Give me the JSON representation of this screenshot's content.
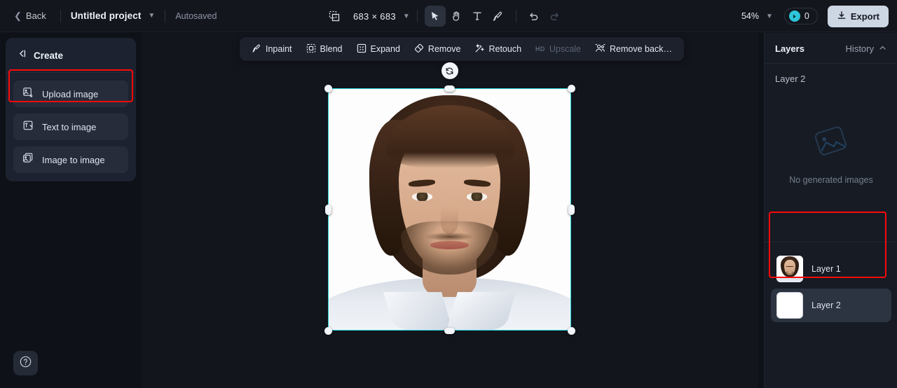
{
  "topbar": {
    "back_label": "Back",
    "back_icon": "chevron-left-icon",
    "project_title": "Untitled project",
    "project_caret_icon": "chevron-down-icon",
    "autosaved_label": "Autosaved",
    "resize_icon": "resize-canvas-icon",
    "canvas_size": "683 × 683",
    "size_caret_icon": "chevron-down-icon",
    "tools": [
      {
        "name": "select-tool",
        "icon": "cursor-arrow-icon",
        "active": true
      },
      {
        "name": "hand-tool",
        "icon": "hand-icon",
        "active": false
      },
      {
        "name": "text-tool",
        "icon": "text-t-icon",
        "active": false
      },
      {
        "name": "brush-tool",
        "icon": "brush-icon",
        "active": false
      },
      {
        "name": "undo",
        "icon": "undo-arrow-icon",
        "active": false
      },
      {
        "name": "redo",
        "icon": "redo-arrow-icon",
        "active": false
      }
    ],
    "zoom_level": "54%",
    "zoom_caret_icon": "chevron-down-icon",
    "credits_count": "0",
    "credits_icon": "credit-coin-icon",
    "export_label": "Export",
    "export_icon": "download-icon"
  },
  "sidebar": {
    "header_label": "Create",
    "header_icon": "collapse-panel-icon",
    "items": [
      {
        "label": "Upload image",
        "icon": "upload-image-icon",
        "highlighted": true
      },
      {
        "label": "Text to image",
        "icon": "text-to-image-icon",
        "highlighted": false
      },
      {
        "label": "Image to image",
        "icon": "image-to-image-icon",
        "highlighted": false
      }
    ],
    "help_icon": "help-question-icon"
  },
  "canvas": {
    "toolbar": [
      {
        "label": "Inpaint",
        "icon": "inpaint-brush-icon",
        "disabled": false,
        "badge": ""
      },
      {
        "label": "Blend",
        "icon": "blend-icon",
        "disabled": false,
        "badge": ""
      },
      {
        "label": "Expand",
        "icon": "expand-icon",
        "disabled": false,
        "badge": ""
      },
      {
        "label": "Remove",
        "icon": "eraser-icon",
        "disabled": false,
        "badge": ""
      },
      {
        "label": "Retouch",
        "icon": "magic-wand-icon",
        "disabled": false,
        "badge": ""
      },
      {
        "label": "Upscale",
        "icon": "hd-icon",
        "disabled": true,
        "badge": "HD"
      },
      {
        "label": "Remove back…",
        "icon": "remove-background-icon",
        "disabled": false,
        "badge": ""
      }
    ],
    "selection": {
      "rotate_icon": "rotate-handle-icon",
      "border_color": "#22d3dd",
      "handle_color": "#f2f5f9"
    },
    "image_alt": "portrait-photo-young-man"
  },
  "right_panel": {
    "tab_layers": "Layers",
    "tab_history": "History",
    "history_caret_icon": "chevron-up-icon",
    "active_layer_label": "Layer 2",
    "empty_state_icon": "image-placeholder-icon",
    "empty_state_text": "No generated images",
    "layers": [
      {
        "name": "Layer 1",
        "thumb": "portrait",
        "selected": false
      },
      {
        "name": "Layer 2",
        "thumb": "blank",
        "selected": true
      }
    ]
  },
  "highlights": {
    "color": "#fb0a0a",
    "boxes": [
      "upload-image-button",
      "layers-list"
    ]
  }
}
